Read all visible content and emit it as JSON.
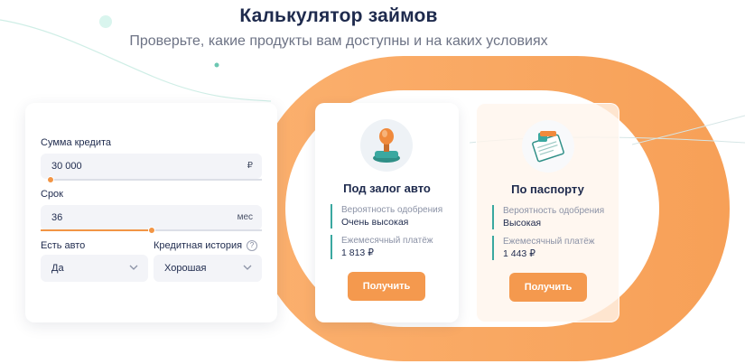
{
  "header": {
    "title": "Калькулятор займов",
    "subtitle": "Проверьте, какие продукты вам доступны и на каких условиях"
  },
  "calculator": {
    "amount": {
      "label": "Сумма кредита",
      "value": "30 000",
      "unit": "₽",
      "slider_fraction": 0.0
    },
    "term": {
      "label": "Срок",
      "value": "36",
      "unit": "мес",
      "slider_fraction": 0.5
    },
    "car": {
      "label": "Есть авто",
      "value": "Да"
    },
    "credit_history": {
      "label": "Кредитная история",
      "value": "Хорошая",
      "help": "?"
    }
  },
  "products": [
    {
      "name": "Под залог авто",
      "approval_label": "Вероятность одобрения",
      "approval_value": "Очень высокая",
      "payment_label": "Ежемесячный платёж",
      "payment_value": "1 813 ₽",
      "button": "Получить",
      "icon": "stamp-icon"
    },
    {
      "name": "По паспорту",
      "approval_label": "Вероятность одобрения",
      "approval_value": "Высокая",
      "payment_label": "Ежемесячный платёж",
      "payment_value": "1 443 ₽",
      "button": "Получить",
      "icon": "passport-icon"
    }
  ],
  "colors": {
    "accent": "#f4994e",
    "teal": "#3aa8a0",
    "text": "#1e2a4d"
  }
}
